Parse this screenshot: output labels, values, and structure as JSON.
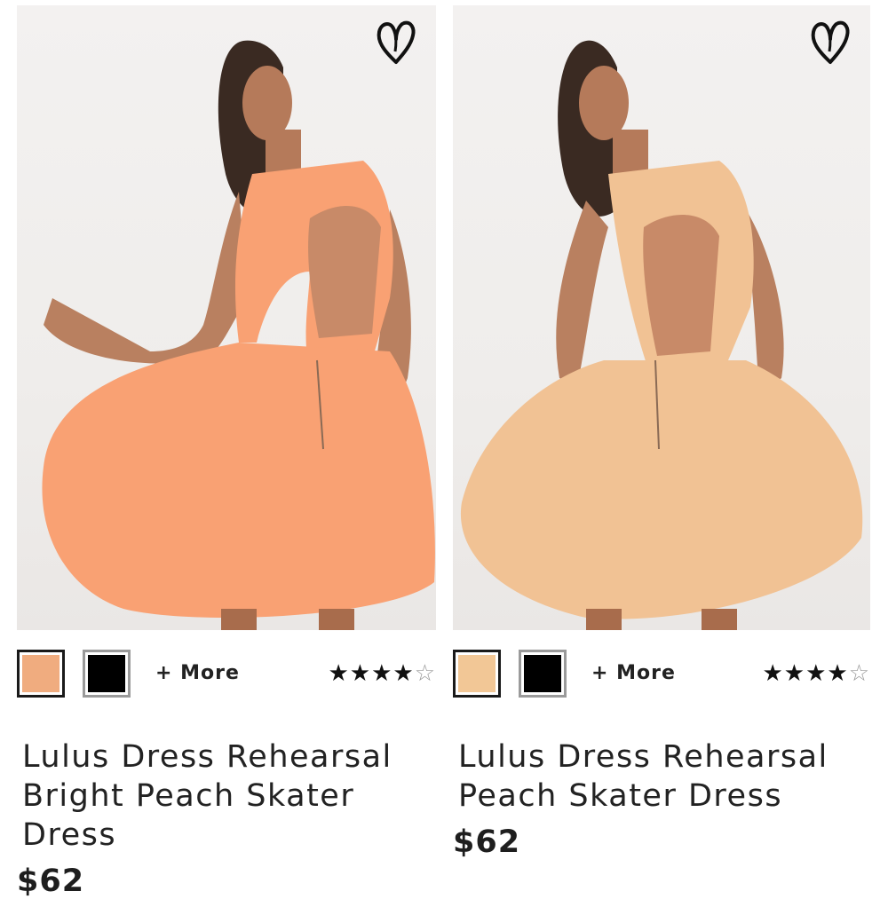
{
  "products": [
    {
      "name": "Lulus Dress Rehearsal Bright Peach Skater Dress",
      "price": "$62",
      "more_label": "+ More",
      "rating_stars": 4,
      "rating_max": 5,
      "swatches": [
        {
          "color": "#f0ac7f",
          "selected": true
        },
        {
          "color": "#000000",
          "selected": false
        }
      ],
      "dress_color": "#f9a173",
      "favorite_icon": "heart-outline-icon"
    },
    {
      "name": "Lulus Dress Rehearsal Peach Skater Dress",
      "price": "$62",
      "more_label": "+ More",
      "rating_stars": 4,
      "rating_max": 5,
      "swatches": [
        {
          "color": "#f2c796",
          "selected": true
        },
        {
          "color": "#000000",
          "selected": false
        }
      ],
      "dress_color": "#f1c294",
      "favorite_icon": "heart-outline-icon"
    }
  ]
}
